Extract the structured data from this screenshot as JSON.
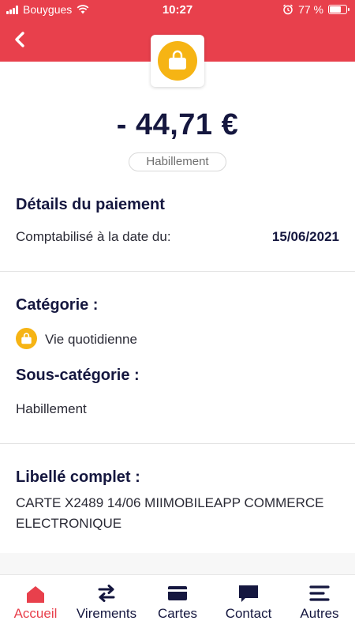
{
  "status_bar": {
    "carrier": "Bouygues",
    "time": "10:27",
    "battery": "77 %"
  },
  "header": {
    "category_icon": "shopping-bag-icon"
  },
  "transaction": {
    "amount": "- 44,71 €",
    "category_chip": "Habillement"
  },
  "details": {
    "title": "Détails du paiement",
    "date_label": "Comptabilisé à la date du:",
    "date_value": "15/06/2021"
  },
  "category": {
    "title": "Catégorie :",
    "value": "Vie quotidienne",
    "sub_title": "Sous-catégorie :",
    "sub_value": "Habillement"
  },
  "libelle": {
    "title": "Libellé complet :",
    "line1": "CARTE X2489 14/06 MIIMOBILEAPP COMMERCE",
    "line2": "ELECTRONIQUE"
  },
  "tabbar": {
    "items": [
      {
        "label": "Accueil",
        "icon": "home-icon",
        "active": true
      },
      {
        "label": "Virements",
        "icon": "transfer-icon",
        "active": false
      },
      {
        "label": "Cartes",
        "icon": "card-icon",
        "active": false
      },
      {
        "label": "Contact",
        "icon": "chat-icon",
        "active": false
      },
      {
        "label": "Autres",
        "icon": "menu-icon",
        "active": false
      }
    ]
  },
  "colors": {
    "brand_red": "#e8404c",
    "navy": "#15173f",
    "category_yellow": "#f6b414"
  }
}
